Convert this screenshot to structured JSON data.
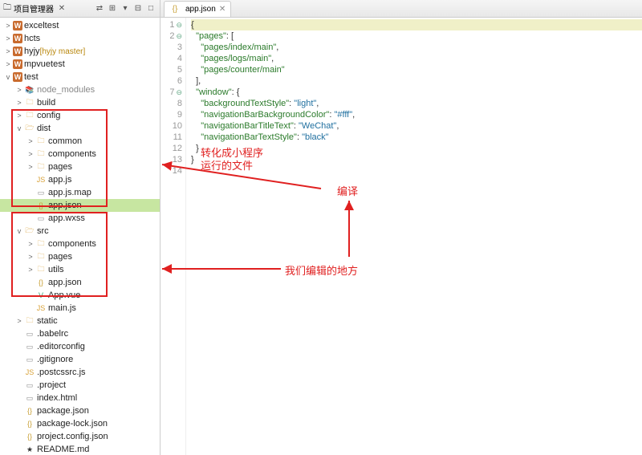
{
  "sidebar": {
    "title": "项目管理器",
    "close_icon": "✕",
    "toolbar_icons": [
      "⇄",
      "⊞",
      "▾",
      "⊟",
      "□"
    ],
    "tree": [
      {
        "d": 0,
        "tw": ">",
        "ico": "w",
        "label": "exceltest"
      },
      {
        "d": 0,
        "tw": ">",
        "ico": "w",
        "label": "hcts"
      },
      {
        "d": 0,
        "tw": ">",
        "ico": "w",
        "label": "hyjy",
        "branch": "[hyjy master]"
      },
      {
        "d": 0,
        "tw": ">",
        "ico": "w",
        "label": "mpvuetest"
      },
      {
        "d": 0,
        "tw": "v",
        "ico": "w",
        "label": "test"
      },
      {
        "d": 1,
        "tw": ">",
        "ico": "lib",
        "label": "node_modules",
        "gray": true
      },
      {
        "d": 1,
        "tw": ">",
        "ico": "folder",
        "label": "build"
      },
      {
        "d": 1,
        "tw": ">",
        "ico": "folder",
        "label": "config"
      },
      {
        "d": 1,
        "tw": "v",
        "ico": "folder-open",
        "label": "dist"
      },
      {
        "d": 2,
        "tw": ">",
        "ico": "folder",
        "label": "common"
      },
      {
        "d": 2,
        "tw": ">",
        "ico": "folder",
        "label": "components"
      },
      {
        "d": 2,
        "tw": ">",
        "ico": "folder",
        "label": "pages"
      },
      {
        "d": 2,
        "tw": "",
        "ico": "js",
        "label": "app.js"
      },
      {
        "d": 2,
        "tw": "",
        "ico": "file",
        "label": "app.js.map"
      },
      {
        "d": 2,
        "tw": "",
        "ico": "json",
        "label": "app.json",
        "selected": true
      },
      {
        "d": 2,
        "tw": "",
        "ico": "file",
        "label": "app.wxss"
      },
      {
        "d": 1,
        "tw": "v",
        "ico": "folder-open",
        "label": "src"
      },
      {
        "d": 2,
        "tw": ">",
        "ico": "folder",
        "label": "components"
      },
      {
        "d": 2,
        "tw": ">",
        "ico": "folder",
        "label": "pages"
      },
      {
        "d": 2,
        "tw": ">",
        "ico": "folder",
        "label": "utils"
      },
      {
        "d": 2,
        "tw": "",
        "ico": "json",
        "label": "app.json"
      },
      {
        "d": 2,
        "tw": "",
        "ico": "vue",
        "label": "App.vue"
      },
      {
        "d": 2,
        "tw": "",
        "ico": "js",
        "label": "main.js"
      },
      {
        "d": 1,
        "tw": ">",
        "ico": "folder",
        "label": "static"
      },
      {
        "d": 1,
        "tw": "",
        "ico": "file",
        "label": ".babelrc"
      },
      {
        "d": 1,
        "tw": "",
        "ico": "file",
        "label": ".editorconfig"
      },
      {
        "d": 1,
        "tw": "",
        "ico": "file",
        "label": ".gitignore"
      },
      {
        "d": 1,
        "tw": "",
        "ico": "js",
        "label": ".postcssrc.js"
      },
      {
        "d": 1,
        "tw": "",
        "ico": "file",
        "label": ".project"
      },
      {
        "d": 1,
        "tw": "",
        "ico": "file",
        "label": "index.html"
      },
      {
        "d": 1,
        "tw": "",
        "ico": "json",
        "label": "package.json"
      },
      {
        "d": 1,
        "tw": "",
        "ico": "json",
        "label": "package-lock.json"
      },
      {
        "d": 1,
        "tw": "",
        "ico": "json",
        "label": "project.config.json"
      },
      {
        "d": 1,
        "tw": "",
        "ico": "star",
        "label": "README.md"
      }
    ]
  },
  "editor": {
    "tab_label": "app.json",
    "tab_close": "✕",
    "lines": [
      {
        "n": 1,
        "hl": true,
        "html": "<span class='k-brace'>{</span>"
      },
      {
        "n": 2,
        "html": "  <span class='k-key'>\"pages\"</span><span class='k-punc'>: [</span>"
      },
      {
        "n": 3,
        "html": "    <span class='k-str'>\"pages/index/main\"</span><span class='k-punc'>,</span>"
      },
      {
        "n": 4,
        "html": "    <span class='k-str'>\"pages/logs/main\"</span><span class='k-punc'>,</span>"
      },
      {
        "n": 5,
        "html": "    <span class='k-str'>\"pages/counter/main\"</span>"
      },
      {
        "n": 6,
        "html": "  <span class='k-punc'>],</span>"
      },
      {
        "n": 7,
        "html": "  <span class='k-key'>\"window\"</span><span class='k-punc'>: {</span>"
      },
      {
        "n": 8,
        "html": "    <span class='k-key'>\"backgroundTextStyle\"</span><span class='k-punc'>:</span> <span class='k-val'>\"light\"</span><span class='k-punc'>,</span>"
      },
      {
        "n": 9,
        "html": "    <span class='k-key'>\"navigationBarBackgroundColor\"</span><span class='k-punc'>:</span> <span class='k-val'>\"#fff\"</span><span class='k-punc'>,</span>"
      },
      {
        "n": 10,
        "html": "    <span class='k-key'>\"navigationBarTitleText\"</span><span class='k-punc'>:</span> <span class='k-val'>\"WeChat\"</span><span class='k-punc'>,</span>"
      },
      {
        "n": 11,
        "html": "    <span class='k-key'>\"navigationBarTextStyle\"</span><span class='k-punc'>:</span> <span class='k-val'>\"black\"</span>"
      },
      {
        "n": 12,
        "html": "  <span class='k-punc'>}</span>"
      },
      {
        "n": 13,
        "html": "<span class='k-brace'>}</span>"
      },
      {
        "n": 14,
        "html": ""
      }
    ]
  },
  "annotations": {
    "label1_line1": "转化成小程序",
    "label1_line2": "运行的文件",
    "label2": "编译",
    "label3": "我们编辑的地方"
  }
}
